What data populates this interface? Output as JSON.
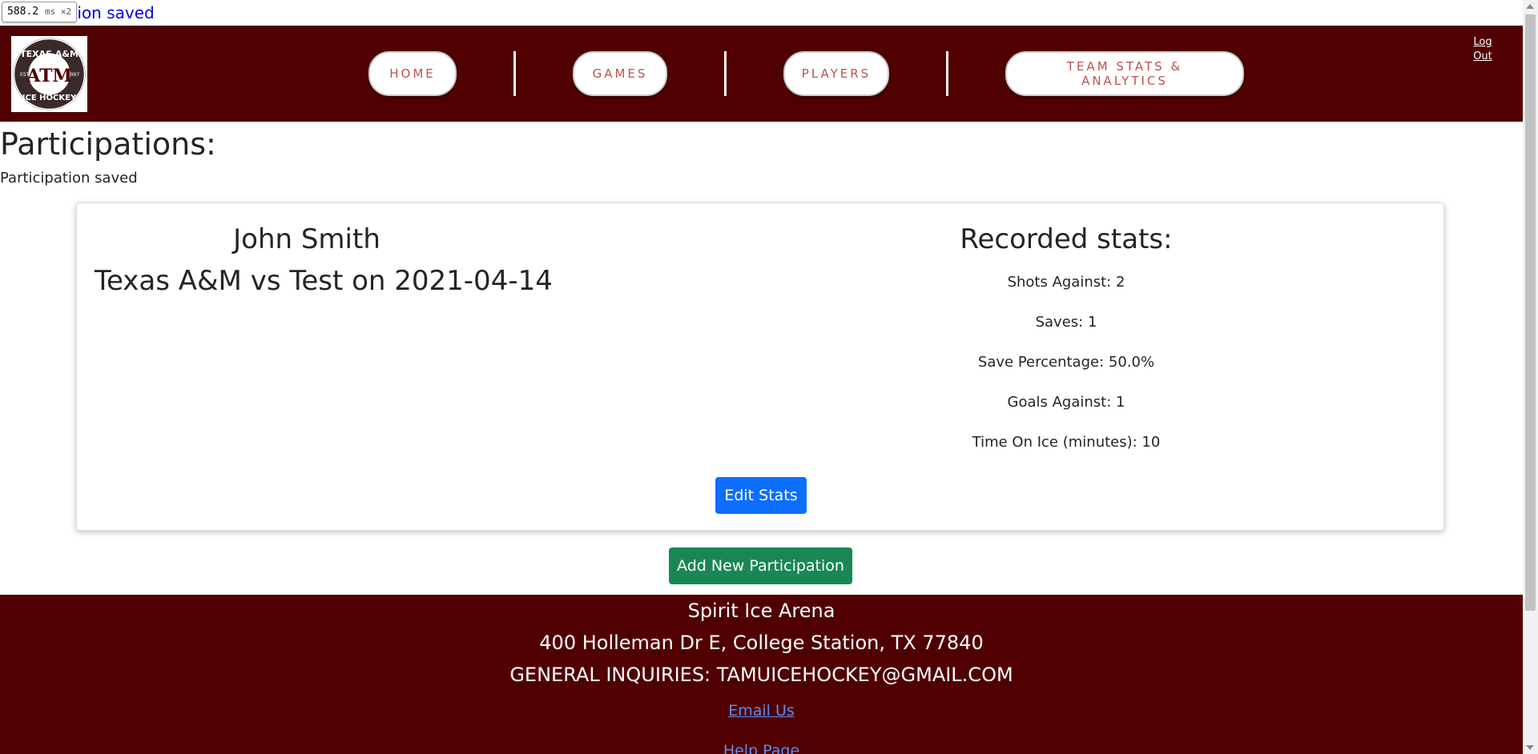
{
  "perf_badge": {
    "value": "588.2",
    "unit": "ms ×2"
  },
  "flash_line": "Participation saved",
  "header": {
    "logo_alt": "TEXAS A&M ICE HOCKEY",
    "logo_text": {
      "top": "TEXAS A&M",
      "bottom": "ICE HOCKEY",
      "left": "EST.",
      "right": "1997",
      "center": "ATM"
    },
    "nav": [
      {
        "label": "HOME"
      },
      {
        "label": "GAMES"
      },
      {
        "label": "PLAYERS"
      },
      {
        "label": "TEAM STATS & ANALYTICS"
      }
    ],
    "logout": {
      "line1": "Log",
      "line2": "Out"
    }
  },
  "main": {
    "title": "Participations:",
    "flash": "Participation saved",
    "card": {
      "player_name": "John Smith",
      "game": "Texas A&M vs Test on 2021-04-14",
      "stats_heading": "Recorded stats:",
      "stats": [
        "Shots Against: 2",
        "Saves: 1",
        "Save Percentage: 50.0%",
        "Goals Against: 1",
        "Time On Ice (minutes): 10"
      ],
      "edit_label": "Edit Stats"
    },
    "add_label": "Add New Participation"
  },
  "footer": {
    "venue": "Spirit Ice Arena",
    "address": "400 Holleman Dr E, College Station, TX 77840",
    "inquiries": "GENERAL INQUIRIES: TAMUICEHOCKEY@GMAIL.COM",
    "email_link": "Email Us",
    "help_link": "Help Page"
  },
  "colors": {
    "maroon": "#500000",
    "nav_text": "#c0504d",
    "primary": "#0d6efd",
    "success": "#198754"
  }
}
